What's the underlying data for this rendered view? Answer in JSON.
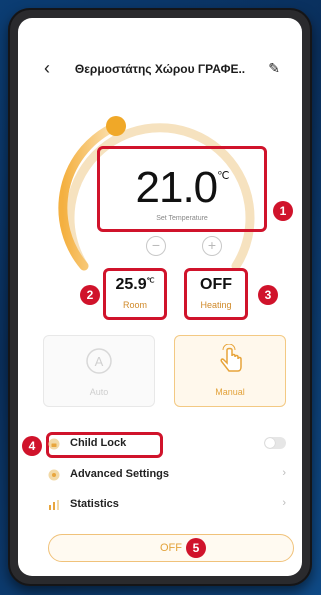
{
  "header": {
    "back_icon": "chevron-left-icon",
    "title": "Θερμοστάτης Χώρου ΓΡΑΦΕ..",
    "edit_icon": "pencil-icon"
  },
  "dial": {
    "set_value": "21.0",
    "set_unit": "℃",
    "set_label": "Set Temperature",
    "minus_label": "−",
    "plus_label": "+",
    "arc_color": "#f0b43c"
  },
  "room": {
    "value": "25.9",
    "unit": "℃",
    "label": "Room"
  },
  "heating": {
    "value": "OFF",
    "label": "Heating"
  },
  "modes": {
    "auto_label": "Auto",
    "manual_label": "Manual"
  },
  "menu": {
    "child_lock": "Child Lock",
    "advanced_settings": "Advanced Settings",
    "statistics": "Statistics"
  },
  "power_button": "OFF",
  "markers": [
    "1",
    "2",
    "3",
    "4",
    "5"
  ],
  "colors": {
    "accent": "#f0b43c",
    "highlight": "#d0132b"
  }
}
